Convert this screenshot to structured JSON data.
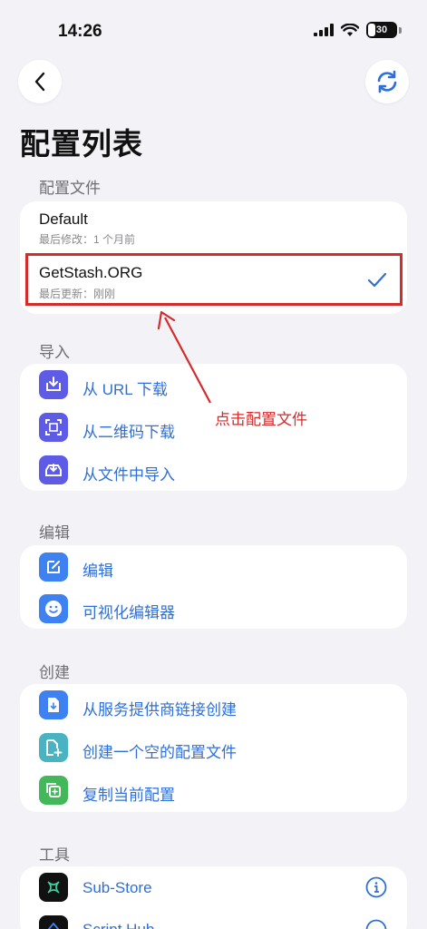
{
  "status": {
    "time": "14:26",
    "battery": "30"
  },
  "page": {
    "title": "配置列表"
  },
  "sections": {
    "profiles": {
      "label": "配置文件",
      "items": [
        {
          "name": "Default",
          "subtitle": "最后修改：1 个月前"
        },
        {
          "name": "GetStash.ORG",
          "subtitle": "最后更新：刚刚",
          "selected": true
        }
      ]
    },
    "import": {
      "label": "导入",
      "items": [
        {
          "label": "从 URL 下载",
          "icon": "download-icon"
        },
        {
          "label": "从二维码下载",
          "icon": "qrcode-icon"
        },
        {
          "label": "从文件中导入",
          "icon": "tray-import-icon"
        }
      ]
    },
    "edit": {
      "label": "编辑",
      "items": [
        {
          "label": "编辑",
          "icon": "edit-icon"
        },
        {
          "label": "可视化编辑器",
          "icon": "smiley-icon"
        }
      ]
    },
    "create": {
      "label": "创建",
      "items": [
        {
          "label": "从服务提供商链接创建",
          "icon": "doc-download-icon"
        },
        {
          "label": "创建一个空的配置文件",
          "icon": "doc-plus-icon"
        },
        {
          "label": "复制当前配置",
          "icon": "copy-icon"
        }
      ]
    },
    "tools": {
      "label": "工具",
      "items": [
        {
          "label": "Sub-Store",
          "icon": "substore-icon"
        },
        {
          "label": "Script Hub",
          "icon": "scripthub-icon"
        }
      ]
    }
  },
  "annotation": {
    "text": "点击配置文件"
  },
  "colors": {
    "accent": "#2f6fd8",
    "annotation": "#d42b2b",
    "purple": "#5e5ce6",
    "blue": "#3d82f0",
    "teal": "#49b3c2",
    "green": "#43b85a"
  }
}
